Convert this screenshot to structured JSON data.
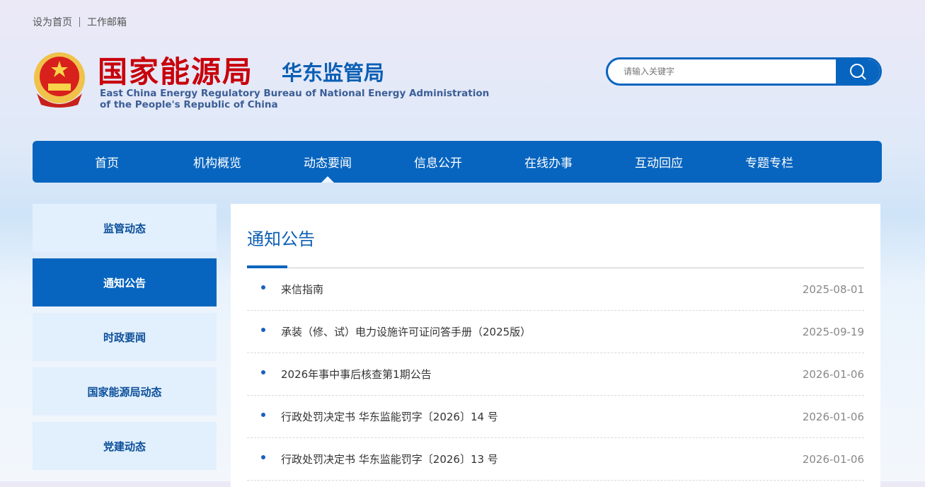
{
  "top_links": [
    "设为首页",
    "工作邮箱"
  ],
  "header": {
    "title_cn": "国家能源局",
    "title_sub": "华东监管局",
    "title_en_1": "East China Energy Regulatory Bureau of National Energy Administration",
    "title_en_2": "of the People's Republic of China"
  },
  "search": {
    "placeholder": "请输入关键字"
  },
  "nav": [
    "首页",
    "机构概览",
    "动态要闻",
    "信息公开",
    "在线办事",
    "互动回应",
    "专题专栏"
  ],
  "sidebar": [
    "监管动态",
    "通知公告",
    "时政要闻",
    "国家能源局动态",
    "党建动态"
  ],
  "main": {
    "title": "通知公告",
    "items": [
      {
        "title": "来信指南",
        "date": "2025-08-01"
      },
      {
        "title": "承装（修、试）电力设施许可证问答手册（2025版）",
        "date": "2025-09-19"
      },
      {
        "title": "2026年事中事后核查第1期公告",
        "date": "2026-01-06"
      },
      {
        "title": "行政处罚决定书 华东监能罚字〔2026〕14 号",
        "date": "2026-01-06"
      },
      {
        "title": "行政处罚决定书 华东监能罚字〔2026〕13 号",
        "date": "2026-01-06"
      }
    ]
  }
}
